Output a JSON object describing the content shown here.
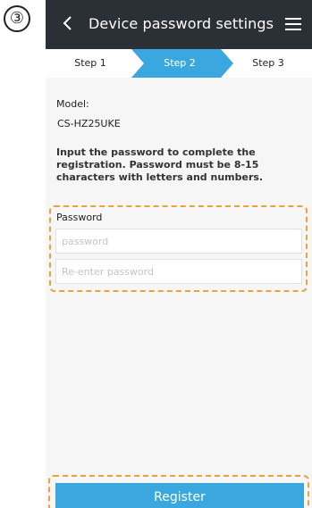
{
  "step_marker": "③",
  "header": {
    "title": "Device password settings",
    "back_icon": "chevron-left-icon",
    "menu_icon": "hamburger-menu-icon",
    "background": "#2b2f36"
  },
  "steps": {
    "items": [
      "Step 1",
      "Step 2",
      "Step 3"
    ],
    "active_index": 1,
    "active_color": "#3aa8df"
  },
  "content": {
    "model_label": "Model:",
    "model_value": "CS-HZ25UKE",
    "instructions": "Input the password to complete the registration. Password must be 8-15 characters with letters and numbers."
  },
  "password": {
    "label": "Password",
    "placeholder": "password",
    "confirm_placeholder": "Re-enter password",
    "value": "",
    "confirm_value": ""
  },
  "register_button": {
    "label": "Register",
    "color": "#3aa8df"
  },
  "highlight_color": "#e8a33a"
}
